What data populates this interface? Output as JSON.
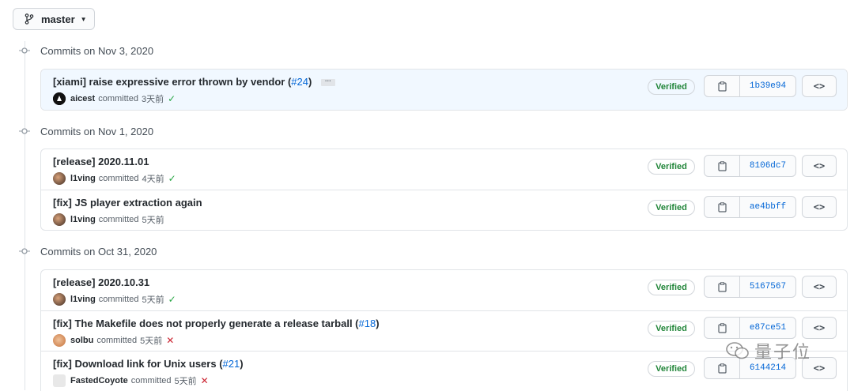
{
  "branch": {
    "label": "master",
    "icon": "git-branch-icon"
  },
  "actions": {
    "verified_label": "Verified",
    "browse_label": "<>",
    "copy_icon": "clipboard-icon"
  },
  "groups": [
    {
      "date_label": "Commits on Nov 3, 2020",
      "commits": [
        {
          "message": "[xiami] raise expressive error thrown by vendor (",
          "issue": "#24",
          "message_tail": ")",
          "has_ellipsis": true,
          "author": "aicest",
          "action": "committed",
          "when": "3天前",
          "status": "check",
          "sha": "1b39e94",
          "highlight": true
        }
      ]
    },
    {
      "date_label": "Commits on Nov 1, 2020",
      "commits": [
        {
          "message": "[release] 2020.11.01",
          "author": "l1ving",
          "action": "committed",
          "when": "4天前",
          "status": "check",
          "sha": "8106dc7"
        },
        {
          "message": "[fix] JS player extraction again",
          "author": "l1ving",
          "action": "committed",
          "when": "5天前",
          "status": "none",
          "sha": "ae4bbff"
        }
      ]
    },
    {
      "date_label": "Commits on Oct 31, 2020",
      "commits": [
        {
          "message": "[release] 2020.10.31",
          "author": "l1ving",
          "action": "committed",
          "when": "5天前",
          "status": "check",
          "sha": "5167567"
        },
        {
          "message": "[fix] The Makefile does not properly generate a release tarball (",
          "issue": "#18",
          "message_tail": ")",
          "author": "solbu",
          "action": "committed",
          "when": "5天前",
          "status": "cross",
          "sha": "e87ce51"
        },
        {
          "message": "[fix] Download link for Unix users (",
          "issue": "#21",
          "message_tail": ")",
          "author": "FastedCoyote",
          "action": "committed",
          "when": "5天前",
          "status": "cross",
          "sha": "6144214"
        }
      ]
    }
  ],
  "watermark": {
    "text": "量子位"
  },
  "colors": {
    "link": "#0366d6",
    "success": "#28a745",
    "danger": "#cb2431",
    "border": "#e1e4e8"
  }
}
